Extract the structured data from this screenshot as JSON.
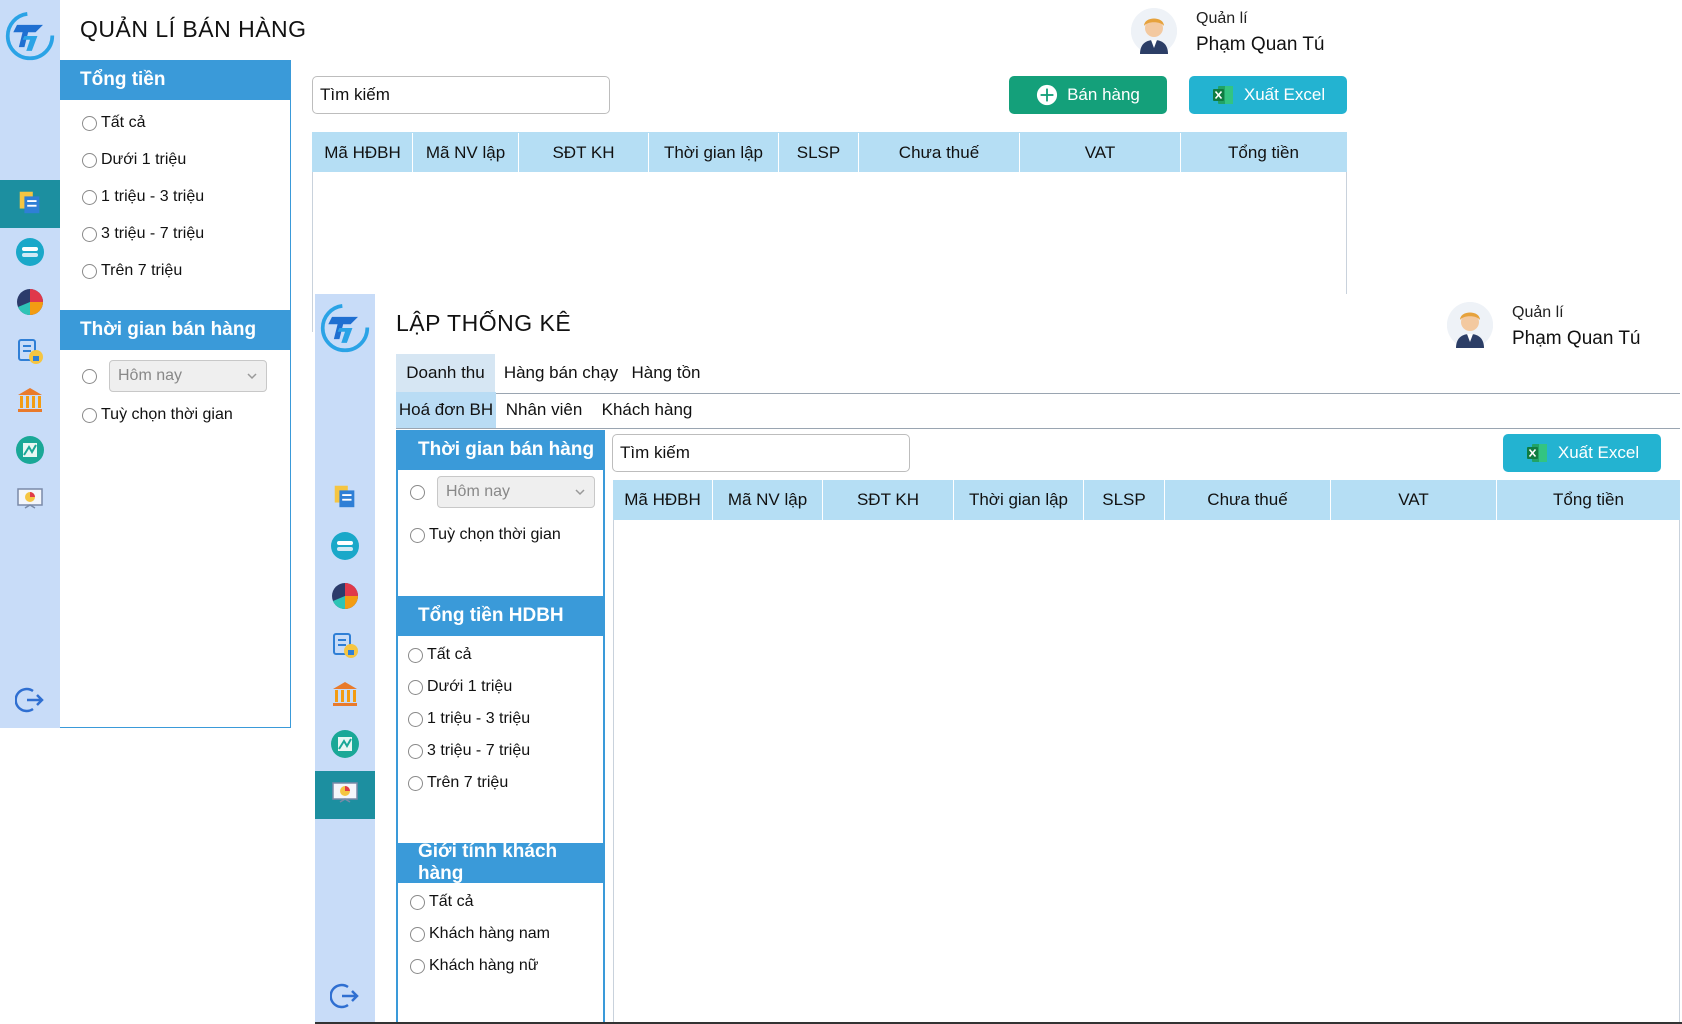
{
  "win1": {
    "title": "QUẢN LÍ BÁN HÀNG",
    "user": {
      "role": "Quản lí",
      "name": "Phạm Quan Tú"
    },
    "search": {
      "value": "Tìm kiếm"
    },
    "buttons": {
      "sell": "Bán hàng",
      "export": "Xuất Excel"
    },
    "total_panel": {
      "heading": "Tổng tiền",
      "options": [
        "Tất cả",
        "Dưới 1 triệu",
        "1 triệu - 3 triệu",
        "3 triệu - 7 triệu",
        "Trên 7 triệu"
      ]
    },
    "time_panel": {
      "heading": "Thời gian bán hàng",
      "select_value": "Hôm nay",
      "custom_option": "Tuỳ chọn thời gian"
    },
    "table_headers": [
      "Mã HĐBH",
      "Mã NV lập",
      "SĐT KH",
      "Thời gian lập",
      "SLSP",
      "Chưa thuế",
      "VAT",
      "Tổng tiền"
    ]
  },
  "win2": {
    "title": "LẬP THỐNG KÊ",
    "user": {
      "role": "Quản lí",
      "name": "Phạm Quan Tú"
    },
    "tabs": [
      "Doanh thu",
      "Hàng bán chạy",
      "Hàng tồn"
    ],
    "subtabs": [
      "Hoá đơn BH",
      "Nhân viên",
      "Khách hàng"
    ],
    "search": {
      "value": "Tìm kiếm"
    },
    "buttons": {
      "export": "Xuất Excel"
    },
    "time_panel": {
      "heading": "Thời gian bán hàng",
      "select_value": "Hôm nay",
      "custom_option": "Tuỳ chọn thời gian"
    },
    "total_panel": {
      "heading": "Tổng tiền HDBH",
      "options": [
        "Tất cả",
        "Dưới 1 triệu",
        "1 triệu - 3 triệu",
        "3 triệu - 7 triệu",
        "Trên 7 triệu"
      ]
    },
    "gender_panel": {
      "heading": "Giới tính khách hàng",
      "options": [
        "Tất cả",
        "Khách hàng nam",
        "Khách hàng nữ"
      ]
    },
    "table_headers": [
      "Mã HĐBH",
      "Mã NV lập",
      "SĐT KH",
      "Thời gian lập",
      "SLSP",
      "Chưa thuế",
      "VAT",
      "Tổng tiền"
    ]
  },
  "icons": [
    "app-logo-icon",
    "invoice-icon",
    "database-icon",
    "pie-chart-icon",
    "account-lock-icon",
    "bank-icon",
    "map-icon",
    "presentation-chart-icon",
    "logout-icon",
    "excel-icon",
    "plus-icon"
  ],
  "colors": {
    "rail": "#c8dcf8",
    "rail_active": "#1c8fa0",
    "panel_head": "#3a9ad9",
    "table_head": "#b5def4",
    "btn_green": "#14a07a",
    "btn_cyan": "#23b3d1"
  }
}
